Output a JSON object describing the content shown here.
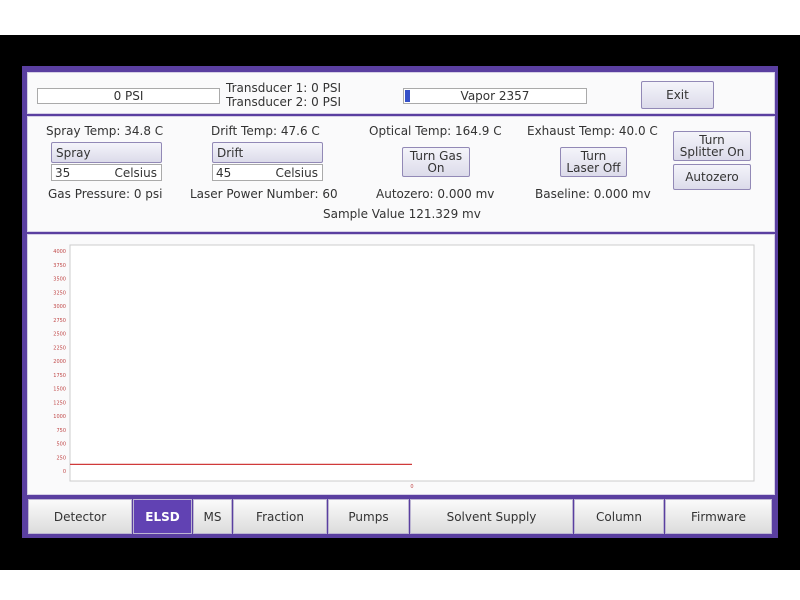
{
  "header": {
    "pressure_display": "0 PSI",
    "transducer1": "Transducer 1: 0 PSI",
    "transducer2": "Transducer 2: 0 PSI",
    "vapor_label": "Vapor 2357",
    "vapor_progress": 0.03,
    "exit_label": "Exit"
  },
  "controls": {
    "spray_temp": "Spray Temp: 34.8 C",
    "drift_temp": "Drift Temp: 47.6 C",
    "optical_temp": "Optical Temp: 164.9 C",
    "exhaust_temp": "Exhaust Temp: 40.0 C",
    "spray_button": "Spray",
    "spray_value": "35",
    "spray_unit": "Celsius",
    "drift_button": "Drift",
    "drift_value": "45",
    "drift_unit": "Celsius",
    "gas_button_line1": "Turn Gas",
    "gas_button_line2": "On",
    "laser_button_line1": "Turn",
    "laser_button_line2": "Laser Off",
    "splitter_button_line1": "Turn",
    "splitter_button_line2": "Splitter On",
    "autozero_button": "Autozero",
    "gas_pressure": "Gas Pressure: 0 psi",
    "laser_power": "Laser Power Number: 60",
    "autozero_value": "Autozero: 0.000 mv",
    "baseline": "Baseline: 0.000 mv",
    "sample_value": "Sample Value 121.329 mv"
  },
  "chart_data": {
    "type": "line",
    "ylim": [
      0,
      4000
    ],
    "y_ticks": [
      "4000",
      "3750",
      "3500",
      "3250",
      "3000",
      "2750",
      "2500",
      "2250",
      "2000",
      "1750",
      "1500",
      "1250",
      "1000",
      "750",
      "500",
      "250",
      "0"
    ],
    "x_tick": "0",
    "series": [
      {
        "color": "#d03a3a",
        "points": [
          [
            0,
            121
          ],
          [
            0.5,
            121
          ]
        ]
      }
    ]
  },
  "tabs": [
    {
      "label": "Detector"
    },
    {
      "label": "ELSD"
    },
    {
      "label": "MS"
    },
    {
      "label": "Fraction"
    },
    {
      "label": "Pumps"
    },
    {
      "label": "Solvent Supply"
    },
    {
      "label": "Column"
    },
    {
      "label": "Firmware"
    }
  ],
  "active_tab": "ELSD",
  "colors": {
    "accent": "#5a3fa0",
    "trace": "#d03a3a",
    "progress": "#3550c8"
  }
}
